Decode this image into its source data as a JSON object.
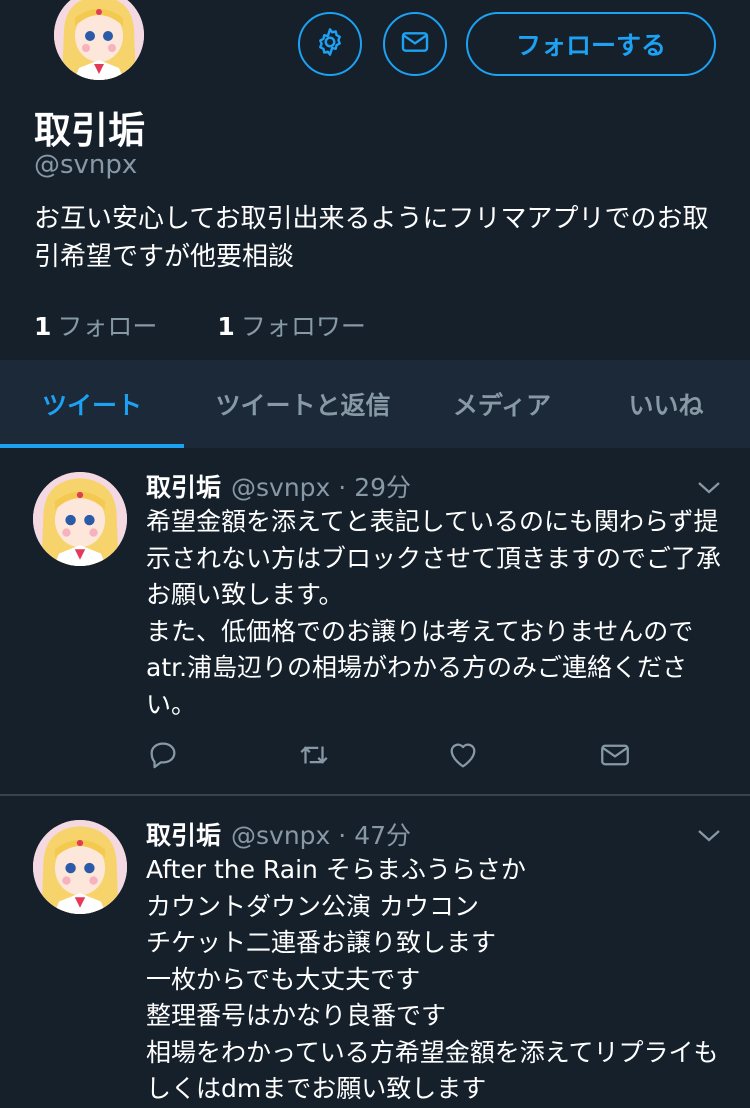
{
  "profile": {
    "name": "取引垢",
    "handle": "@svnpx",
    "bio": "お互い安心してお取引出来るようにフリマアプリでのお取引希望ですが他要相談",
    "following_count": "1",
    "following_label": "フォロー",
    "followers_count": "1",
    "followers_label": "フォロワー"
  },
  "actions": {
    "settings_icon": "gear-icon",
    "message_icon": "envelope-icon",
    "follow_label": "フォローする"
  },
  "tabs": [
    {
      "label": "ツイート",
      "active": true
    },
    {
      "label": "ツイートと返信",
      "active": false
    },
    {
      "label": "メディア",
      "active": false
    },
    {
      "label": "いいね",
      "active": false
    }
  ],
  "tweets": [
    {
      "name": "取引垢",
      "handle": "@svnpx",
      "time": "29分",
      "text": "希望金額を添えてと表記しているのにも関わらず提示されない方はブロックさせて頂きますのでご了承お願い致します。\nまた、低価格でのお譲りは考えておりませんのでatr.浦島辺りの相場がわかる方のみご連絡ください。"
    },
    {
      "name": "取引垢",
      "handle": "@svnpx",
      "time": "47分",
      "text": "After the Rain そらまふうらさか\nカウントダウン公演 カウコン\nチケット二連番お譲り致します\n一枚からでも大丈夫です\n整理番号はかなり良番です\n相場をわかっている方希望金額を添えてリプライもしくはdmまでお願い致します"
    }
  ],
  "colors": {
    "background": "#15202b",
    "tab_bar": "#1c2938",
    "accent": "#1da1f2",
    "muted_text": "#8899a6",
    "divider": "#38444d"
  }
}
